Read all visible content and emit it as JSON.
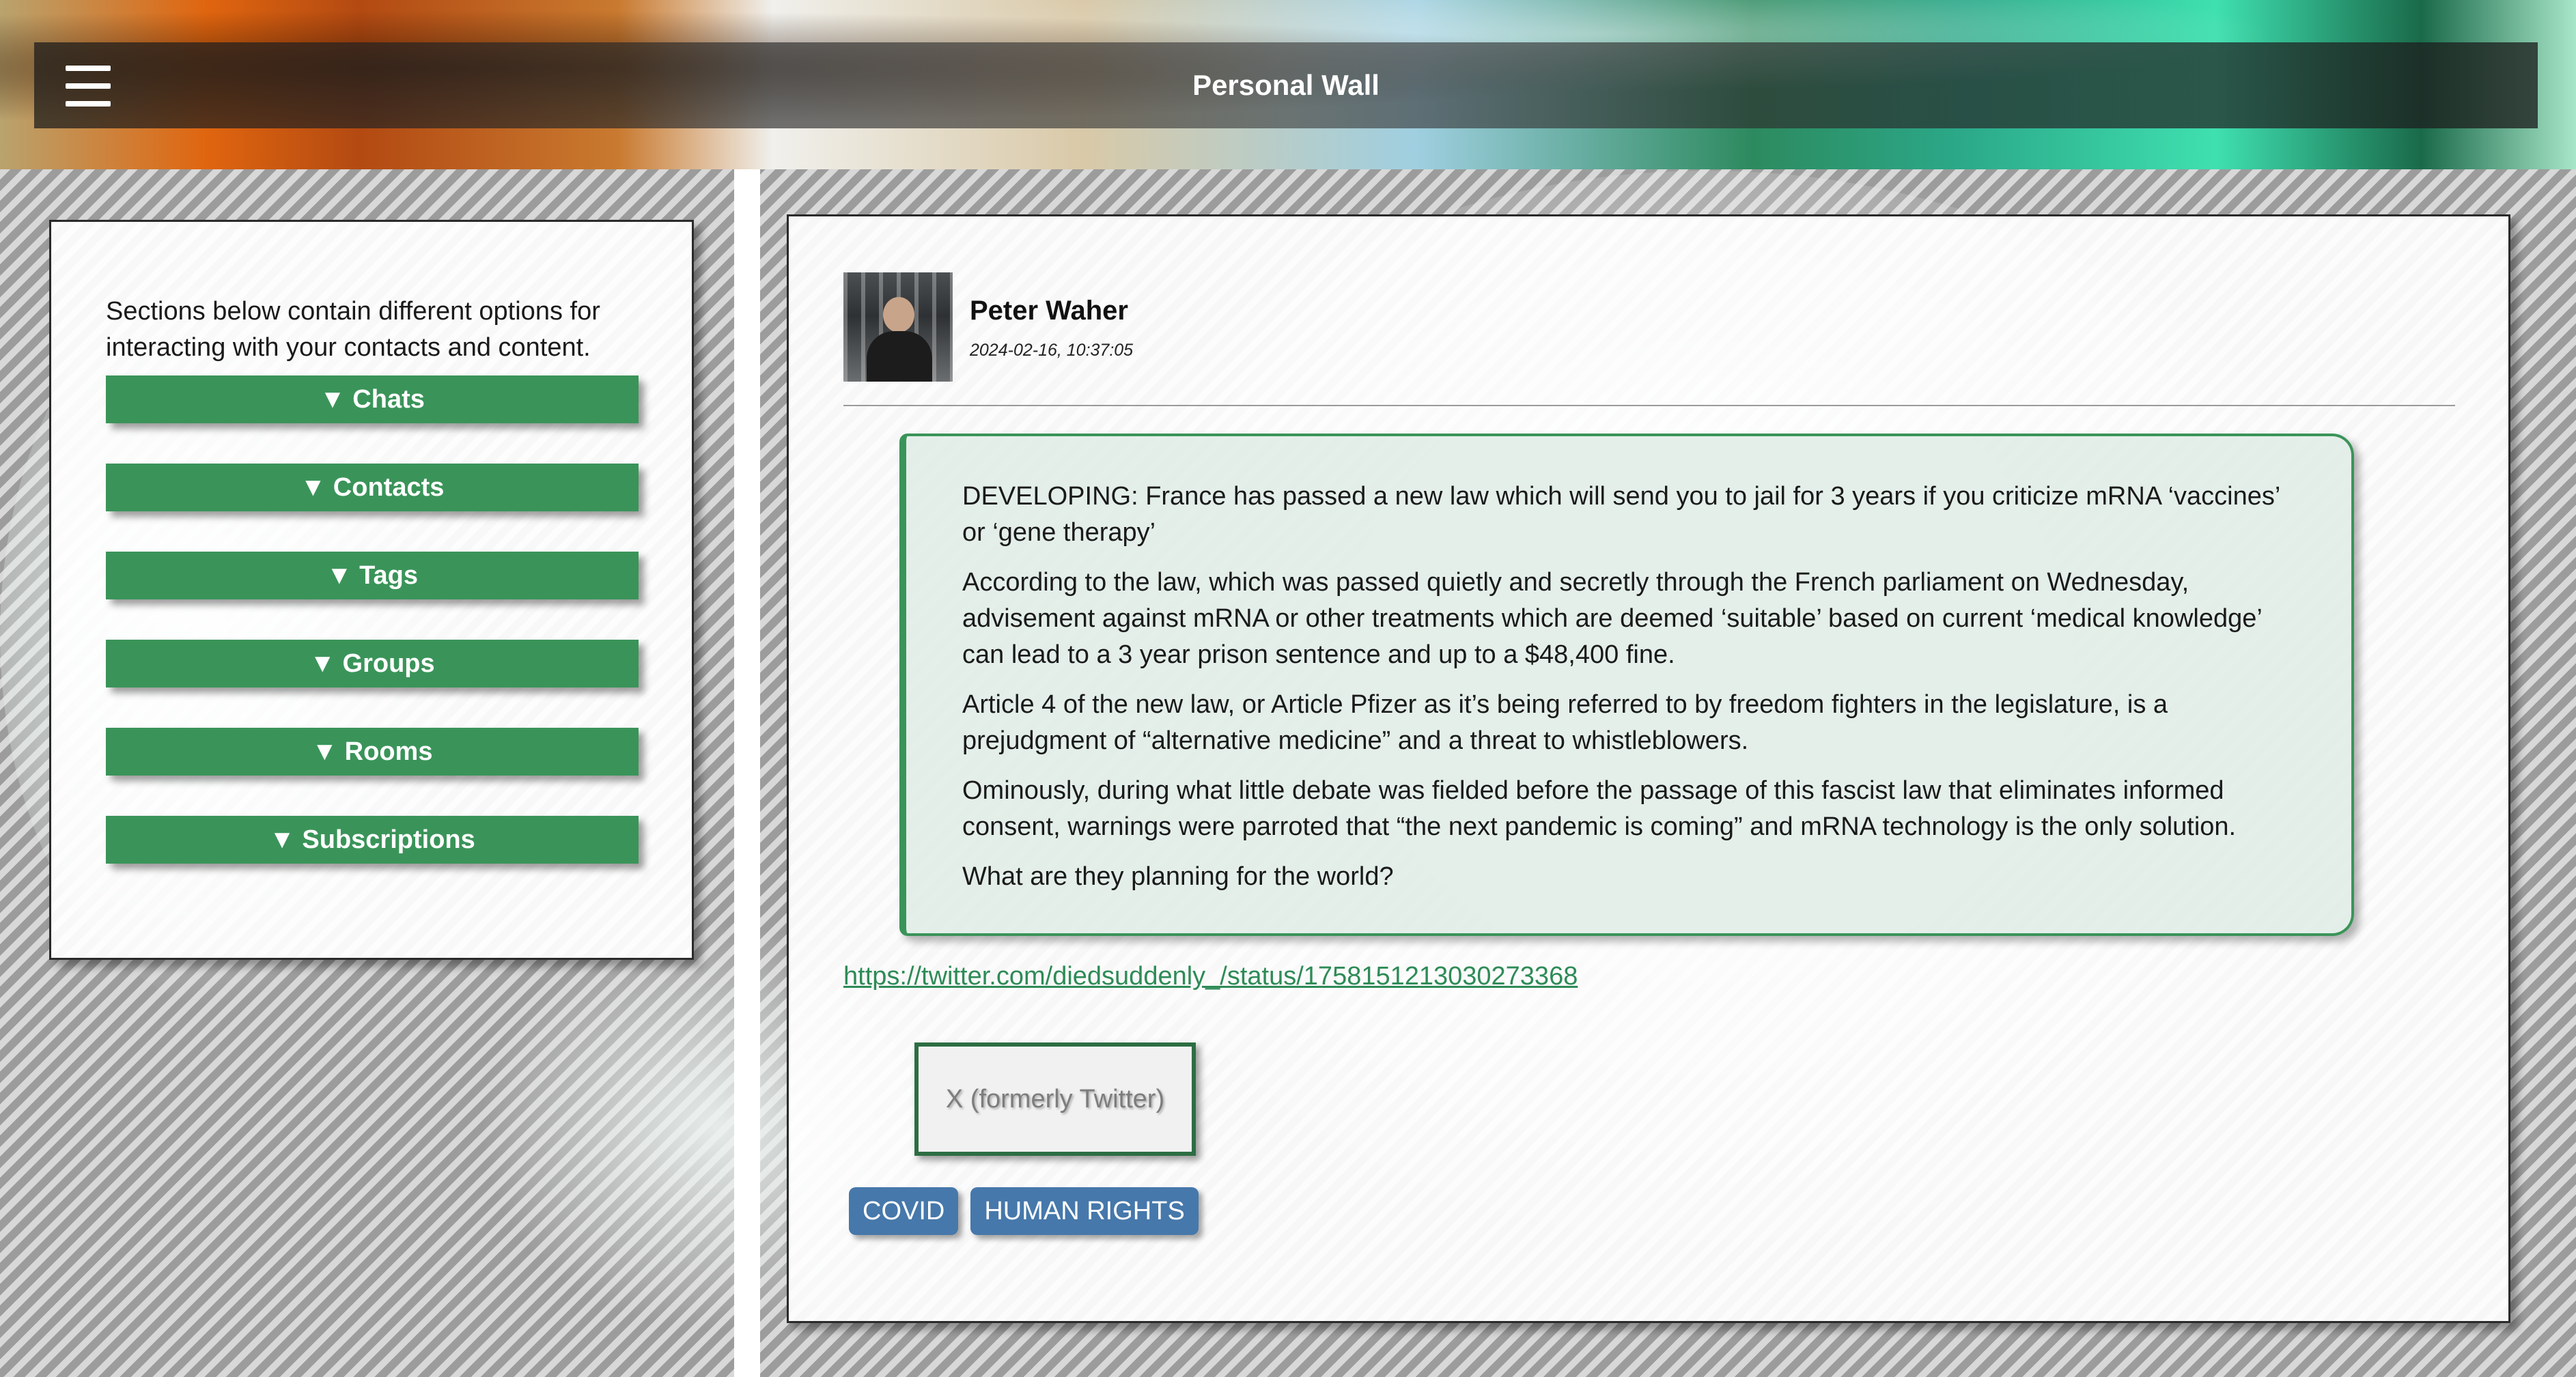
{
  "header": {
    "title": "Personal Wall",
    "menu_icon": "hamburger-menu-icon"
  },
  "sidebar": {
    "intro": "Sections below contain different options for interacting with your contacts and content.",
    "sections": [
      {
        "label": "▼ Chats"
      },
      {
        "label": "▼ Contacts"
      },
      {
        "label": "▼ Tags"
      },
      {
        "label": "▼ Groups"
      },
      {
        "label": "▼ Rooms"
      },
      {
        "label": "▼ Subscriptions"
      }
    ]
  },
  "post": {
    "author": "Peter Waher",
    "date": "2024-02-16, 10:37:05",
    "paragraphs": [
      "DEVELOPING: France has passed a new law which will send you to jail for 3 years if you criticize mRNA ‘vaccines’ or ‘gene therapy’",
      "According to the law, which was passed quietly and secretly through the French parliament on Wednesday, advisement against mRNA or other treatments which are deemed ‘suitable’ based on current ‘medical knowledge’ can lead to a 3 year prison sentence and up to a $48,400 fine.",
      "Article 4 of the new law, or Article Pfizer as it’s being referred to by freedom fighters in the legislature, is a prejudgment of “alternative medicine” and a threat to whistleblowers.",
      "Ominously, during what little debate was fielded before the passage of this fascist law that eliminates informed consent, warnings were parroted that “the next pandemic is coming” and mRNA technology is the only solution.",
      "What are they planning for the world?"
    ],
    "link": "https://twitter.com/diedsuddenly_/status/1758151213030273368",
    "embed_label": "X (formerly Twitter)",
    "tags": [
      {
        "label": "COVID"
      },
      {
        "label": "HUMAN RIGHTS"
      }
    ]
  },
  "colors": {
    "accent_green": "#3a9459",
    "link_green": "#2e8b57",
    "tag_blue": "#4678ab"
  }
}
